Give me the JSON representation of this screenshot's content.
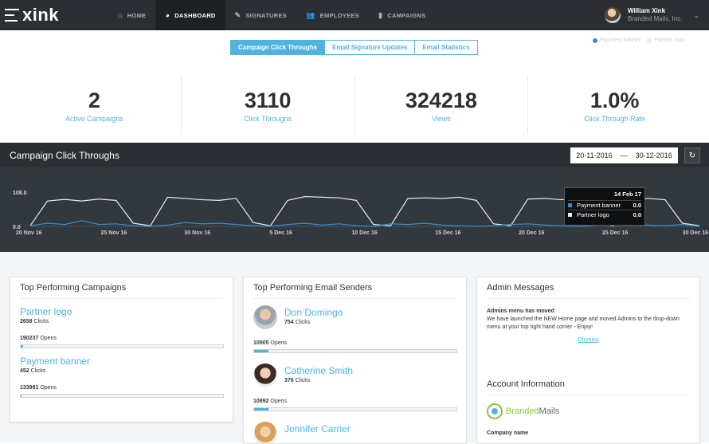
{
  "brand": {
    "logo_text": "xink"
  },
  "nav": {
    "items": [
      {
        "label": "HOME",
        "icon": "home-icon",
        "glyph": "⌂"
      },
      {
        "label": "DASHBOARD",
        "icon": "dashboard-icon",
        "glyph": "◕"
      },
      {
        "label": "SIGNATURES",
        "icon": "signature-icon",
        "glyph": "✎"
      },
      {
        "label": "EMPLOYEES",
        "icon": "employees-icon",
        "glyph": "👥"
      },
      {
        "label": "CAMPAIGNS",
        "icon": "campaigns-icon",
        "glyph": "▮"
      }
    ],
    "active": "DASHBOARD"
  },
  "user": {
    "name": "William Xink",
    "company": "Branded Mails, Inc.",
    "caret": "⌄"
  },
  "tabs": [
    "Campaign Click Throughs",
    "Email Signature Updates",
    "Email Statistics"
  ],
  "stats": [
    {
      "value": "2",
      "label": "Active Campaigns"
    },
    {
      "value": "3110",
      "label": "Click Throughs"
    },
    {
      "value": "324218",
      "label": "Views"
    },
    {
      "value": "1.0%",
      "label": "Click Through Rate"
    }
  ],
  "chart": {
    "title": "Campaign Click Throughs",
    "date_from": "20-11-2016",
    "date_sep": "—",
    "date_to": "30-12-2016",
    "refresh_glyph": "↻",
    "tooltip": {
      "date": "14 Feb 17",
      "rows": [
        {
          "label": "Payment banner",
          "value": "0.0"
        },
        {
          "label": "Partner logo",
          "value": "0.0"
        }
      ]
    }
  },
  "chart_data": {
    "type": "line",
    "ylim": [
      0,
      108.0
    ],
    "ytick_labels": [
      "108.0",
      "0.0"
    ],
    "xtick_labels": [
      "20 Nov 16",
      "25 Nov 16",
      "30 Nov 16",
      "5 Dec 16",
      "10 Dec 16",
      "15 Dec 16",
      "20 Dec 16",
      "25 Dec 16",
      "30 Dec 16"
    ],
    "series": [
      {
        "name": "Payment banner",
        "color": "#2f8fd6",
        "values": [
          2,
          10,
          6,
          18,
          6,
          8,
          2,
          0,
          4,
          12,
          8,
          10,
          6,
          2,
          0,
          6,
          10,
          4,
          8,
          2,
          0,
          8,
          6,
          10,
          4,
          2,
          0,
          2,
          6,
          8,
          4,
          2,
          0,
          4,
          8,
          6,
          4,
          2,
          6,
          0
        ]
      },
      {
        "name": "Partner logo",
        "color": "#e6ecf1",
        "values": [
          2,
          80,
          85,
          80,
          86,
          82,
          10,
          2,
          92,
          88,
          84,
          82,
          88,
          12,
          2,
          82,
          94,
          92,
          90,
          82,
          6,
          2,
          88,
          90,
          88,
          92,
          82,
          8,
          2,
          86,
          88,
          84,
          90,
          10,
          2,
          80,
          88,
          84,
          10,
          2
        ]
      }
    ]
  },
  "campaigns": {
    "title": "Top Performing Campaigns",
    "items": [
      {
        "name": "Partner logo",
        "clicks": "2658",
        "clicks_label": "Clicks",
        "opens": "190237",
        "opens_label": "Opens",
        "fraction": 0.01
      },
      {
        "name": "Payment banner",
        "clicks": "452",
        "clicks_label": "Clicks",
        "opens": "133981",
        "opens_label": "Opens",
        "fraction": 0.005
      }
    ]
  },
  "senders": {
    "title": "Top Performing Email Senders",
    "items": [
      {
        "name": "Don Domingo",
        "clicks": "754",
        "clicks_label": "Clicks",
        "opens": "10905",
        "opens_label": "Opens",
        "fraction": 0.07
      },
      {
        "name": "Catherine Smith",
        "clicks": "376",
        "clicks_label": "Clicks",
        "opens": "10892",
        "opens_label": "Opens",
        "fraction": 0.07
      },
      {
        "name": "Jennifer Carrier"
      }
    ]
  },
  "admin": {
    "title": "Admin Messages",
    "msg_title": "Admins menu has moved",
    "msg_body": "We have launched the NEW Home page and moved Admins to the drop-down menu at your top right hand corner - Enjoy!",
    "dismiss": "Dismiss",
    "account_title": "Account Information",
    "brand_name_1": "Branded",
    "brand_name_2": "Mails",
    "company_label": "Company name"
  }
}
